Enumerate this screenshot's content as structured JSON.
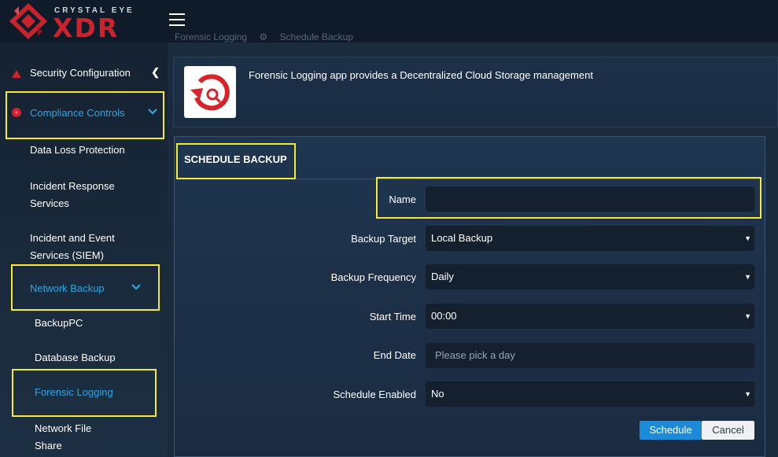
{
  "brand": {
    "small": "CRYSTAL EYE",
    "big": "XDR",
    "accent": "#c9232e"
  },
  "breadcrumb": {
    "items": [
      "Forensic Logging",
      "Schedule Backup"
    ],
    "separator_icon": "gear-icon"
  },
  "sidebar": {
    "items": [
      {
        "label": "Security Configuration",
        "icon": "warning-triangle-icon"
      },
      {
        "label": "Compliance Controls",
        "icon": "shield-dot-icon"
      },
      {
        "label": "Data Loss Protection"
      },
      {
        "label": "Incident Response Services"
      },
      {
        "label": "Incident and Event Services (SIEM)"
      },
      {
        "label": "Network Backup"
      },
      {
        "label": "BackupPC"
      },
      {
        "label": "Database Backup"
      },
      {
        "label": "Forensic Logging"
      },
      {
        "label": "Network File Share"
      }
    ],
    "label_lines": {
      "incident_response_1": "Incident Response",
      "incident_response_2": "Services",
      "siem_1": "Incident and Event",
      "siem_2": "Services (SIEM)",
      "nfs_1": "Network File",
      "nfs_2": "Share"
    },
    "active_color": "#2aa7e6"
  },
  "app_info": {
    "description": "Forensic Logging app provides a Decentralized Cloud Storage management",
    "icon": "backup-restore-icon"
  },
  "form": {
    "title": "SCHEDULE BACKUP",
    "fields": {
      "name": {
        "label": "Name",
        "value": ""
      },
      "backup_target": {
        "label": "Backup Target",
        "value": "Local Backup"
      },
      "backup_frequency": {
        "label": "Backup Frequency",
        "value": "Daily"
      },
      "start_time": {
        "label": "Start Time",
        "value": "00:00"
      },
      "end_date": {
        "label": "End Date",
        "placeholder": "Please pick a day"
      },
      "schedule_enabled": {
        "label": "Schedule Enabled",
        "value": "No"
      }
    },
    "buttons": {
      "schedule": "Schedule",
      "cancel": "Cancel"
    },
    "primary_color": "#1b8ad8"
  },
  "highlight_color": "#f4ea31"
}
